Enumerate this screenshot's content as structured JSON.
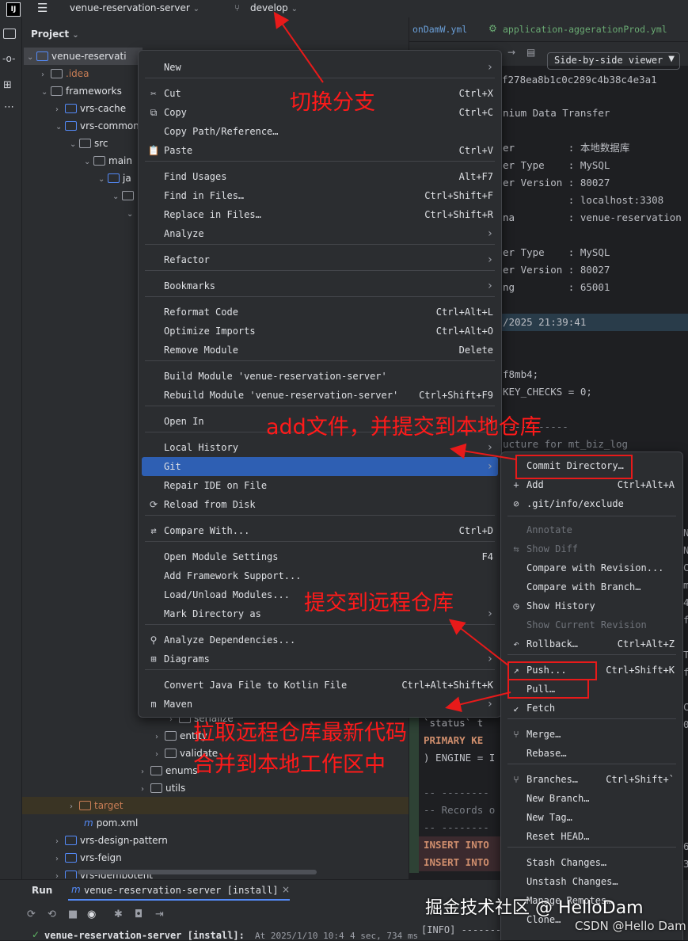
{
  "titlebar": {
    "logo": "IJ",
    "project": "venue-reservation-server",
    "branch": "develop"
  },
  "editor_tabs": {
    "tab1": "onDamW.yml",
    "tab2": "application-aggerationProd.yml"
  },
  "diff_toolbar": {
    "viewer": "Side-by-side viewer",
    "hash": "f278ea8b1c0c289c4b38c4e3a1"
  },
  "project_panel": {
    "title": "Project",
    "tree": [
      {
        "label": "venue-reservati"
      },
      {
        "label": ".idea"
      },
      {
        "label": "frameworks"
      },
      {
        "label": "vrs-cache"
      },
      {
        "label": "vrs-common"
      },
      {
        "label": "src"
      },
      {
        "label": "main"
      },
      {
        "label": "ja"
      },
      {
        "label": "serialize"
      },
      {
        "label": "entity"
      },
      {
        "label": "validate"
      },
      {
        "label": "enums"
      },
      {
        "label": "utils"
      },
      {
        "label": "target"
      },
      {
        "label": "pom.xml"
      },
      {
        "label": "vrs-design-pattern"
      },
      {
        "label": "vrs-feign"
      },
      {
        "label": "vrs-idempotent"
      }
    ]
  },
  "code_lines": [
    "nium Data Transfer",
    "er         : 本地数据库",
    "er Type    : MySQL",
    "er Version : 80027",
    "           : localhost:3308",
    "na         : venue-reservation",
    "er Type    : MySQL",
    "er Version : 80027",
    "ng         : 65001",
    "/2025 21:39:41",
    "f8mb4;",
    "KEY_CHECKS = 0;",
    "-----------",
    "ucture for mt_biz_log"
  ],
  "code_lower": [
    "`status` t",
    "PRIMARY KE",
    ") ENGINE = I",
    "-- --------",
    "-- Records o",
    "-- --------",
    "INSERT INTO",
    "INSERT INTO"
  ],
  "right_edge_chars": [
    "N",
    "N",
    "C",
    "m",
    "4",
    "f",
    "T",
    "f",
    "C",
    "0",
    "6",
    "3"
  ],
  "context_menu": {
    "items": [
      {
        "label": "New",
        "shortcut": "",
        "submenu": true,
        "icon": ""
      },
      {
        "label": "Cut",
        "shortcut": "Ctrl+X",
        "icon": "✂"
      },
      {
        "label": "Copy",
        "shortcut": "Ctrl+C",
        "icon": "⧉"
      },
      {
        "label": "Copy Path/Reference…",
        "shortcut": "",
        "icon": ""
      },
      {
        "label": "Paste",
        "shortcut": "Ctrl+V",
        "icon": "📋"
      },
      {
        "label": "Find Usages",
        "shortcut": "Alt+F7",
        "icon": ""
      },
      {
        "label": "Find in Files…",
        "shortcut": "Ctrl+Shift+F",
        "icon": ""
      },
      {
        "label": "Replace in Files…",
        "shortcut": "Ctrl+Shift+R",
        "icon": ""
      },
      {
        "label": "Analyze",
        "shortcut": "",
        "submenu": true,
        "icon": ""
      },
      {
        "label": "Refactor",
        "shortcut": "",
        "submenu": true,
        "icon": ""
      },
      {
        "label": "Bookmarks",
        "shortcut": "",
        "submenu": true,
        "icon": ""
      },
      {
        "label": "Reformat Code",
        "shortcut": "Ctrl+Alt+L",
        "icon": ""
      },
      {
        "label": "Optimize Imports",
        "shortcut": "Ctrl+Alt+O",
        "icon": ""
      },
      {
        "label": "Remove Module",
        "shortcut": "Delete",
        "icon": ""
      },
      {
        "label": "Build Module 'venue-reservation-server'",
        "shortcut": "",
        "icon": ""
      },
      {
        "label": "Rebuild Module 'venue-reservation-server'",
        "shortcut": "Ctrl+Shift+F9",
        "icon": ""
      },
      {
        "label": "Open In",
        "shortcut": "",
        "submenu": true,
        "icon": ""
      },
      {
        "label": "Local History",
        "shortcut": "",
        "submenu": true,
        "icon": ""
      },
      {
        "label": "Git",
        "shortcut": "",
        "submenu": true,
        "icon": ""
      },
      {
        "label": "Repair IDE on File",
        "shortcut": "",
        "icon": ""
      },
      {
        "label": "Reload from Disk",
        "shortcut": "",
        "icon": "⟳"
      },
      {
        "label": "Compare With...",
        "shortcut": "Ctrl+D",
        "icon": "⇄"
      },
      {
        "label": "Open Module Settings",
        "shortcut": "F4",
        "icon": ""
      },
      {
        "label": "Add Framework Support...",
        "shortcut": "",
        "icon": ""
      },
      {
        "label": "Load/Unload Modules...",
        "shortcut": "",
        "icon": ""
      },
      {
        "label": "Mark Directory as",
        "shortcut": "",
        "submenu": true,
        "icon": ""
      },
      {
        "label": "Analyze Dependencies...",
        "shortcut": "",
        "icon": "⚲"
      },
      {
        "label": "Diagrams",
        "shortcut": "",
        "submenu": true,
        "icon": "⊞"
      },
      {
        "label": "Convert Java File to Kotlin File",
        "shortcut": "Ctrl+Alt+Shift+K",
        "icon": ""
      },
      {
        "label": "Maven",
        "shortcut": "",
        "submenu": true,
        "icon": "m"
      }
    ]
  },
  "git_menu": {
    "items": [
      {
        "label": "Commit Directory…",
        "shortcut": "",
        "icon": "",
        "disabled": false
      },
      {
        "label": "Add",
        "shortcut": "Ctrl+Alt+A",
        "icon": "+",
        "disabled": false
      },
      {
        "label": ".git/info/exclude",
        "shortcut": "",
        "icon": "⊘",
        "disabled": false
      },
      {
        "label": "Annotate",
        "shortcut": "",
        "icon": "",
        "disabled": true
      },
      {
        "label": "Show Diff",
        "shortcut": "",
        "icon": "⇆",
        "disabled": true
      },
      {
        "label": "Compare with Revision...",
        "shortcut": "",
        "icon": "",
        "disabled": false
      },
      {
        "label": "Compare with Branch…",
        "shortcut": "",
        "icon": "",
        "disabled": false
      },
      {
        "label": "Show History",
        "shortcut": "",
        "icon": "◷",
        "disabled": false
      },
      {
        "label": "Show Current Revision",
        "shortcut": "",
        "icon": "",
        "disabled": true
      },
      {
        "label": "Rollback…",
        "shortcut": "Ctrl+Alt+Z",
        "icon": "↶",
        "disabled": false
      },
      {
        "label": "Push...",
        "shortcut": "Ctrl+Shift+K",
        "icon": "↗",
        "disabled": false
      },
      {
        "label": "Pull…",
        "shortcut": "",
        "icon": "",
        "disabled": false
      },
      {
        "label": "Fetch",
        "shortcut": "",
        "icon": "↙",
        "disabled": false
      },
      {
        "label": "Merge…",
        "shortcut": "",
        "icon": "⑂",
        "disabled": false
      },
      {
        "label": "Rebase…",
        "shortcut": "",
        "icon": "",
        "disabled": false
      },
      {
        "label": "Branches…",
        "shortcut": "Ctrl+Shift+`",
        "icon": "⑂",
        "disabled": false
      },
      {
        "label": "New Branch…",
        "shortcut": "",
        "icon": "",
        "disabled": false
      },
      {
        "label": "New Tag…",
        "shortcut": "",
        "icon": "",
        "disabled": false
      },
      {
        "label": "Reset HEAD…",
        "shortcut": "",
        "icon": "",
        "disabled": false
      },
      {
        "label": "Stash Changes…",
        "shortcut": "",
        "icon": "",
        "disabled": false
      },
      {
        "label": "Unstash Changes…",
        "shortcut": "",
        "icon": "",
        "disabled": false
      },
      {
        "label": "Manage Remotes…",
        "shortcut": "",
        "icon": "",
        "disabled": false
      },
      {
        "label": "Clone…",
        "shortcut": "",
        "icon": "",
        "disabled": false
      }
    ]
  },
  "annotations": {
    "switch_branch": "切换分支",
    "add_commit": "add文件，并提交到本地仓库",
    "push": "提交到远程仓库",
    "pull_line1": "拉取远程仓库最新代码",
    "pull_line2": "合并到本地工作区中"
  },
  "run_panel": {
    "tab": "Run",
    "config": "venue-reservation-server [install]",
    "result": "venue-reservation-server [install]:",
    "result_time": "At 2025/1/10 10:4",
    "duration": "4 sec, 734 ms",
    "console": "[INFO] -------"
  },
  "watermarks": {
    "juejin": "掘金技术社区 @ HelloDam",
    "csdn": "CSDN @Hello Dam"
  }
}
